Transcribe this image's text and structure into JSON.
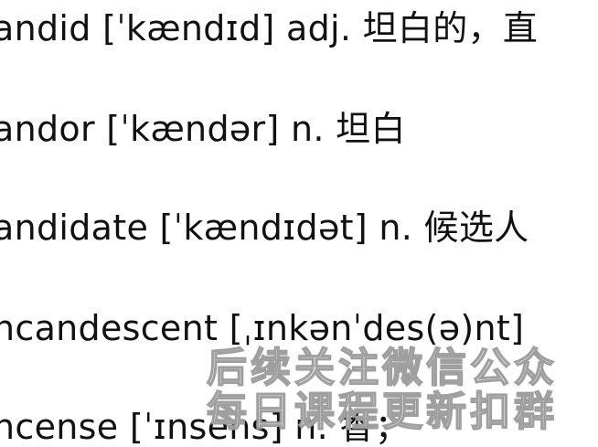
{
  "entries": [
    {
      "word": "andid",
      "phonetic": "[ˈkændɪd]",
      "pos": "adj.",
      "meaning": "坦白的，直"
    },
    {
      "word": "andor",
      "phonetic": "[ˈkændər]",
      "pos": "n.",
      "meaning": "坦白"
    },
    {
      "word": "andidate",
      "phonetic": "[ˈkændɪdət]",
      "pos": "n.",
      "meaning": "候选人"
    },
    {
      "word": "ncandescent",
      "phonetic": "[ˌɪnkənˈdes(ə)nt]",
      "pos": "",
      "meaning": ""
    },
    {
      "word": "ncense",
      "phonetic": "[ˈɪnsens]",
      "pos": "n.",
      "meaning": "香；"
    }
  ],
  "overlay": {
    "line1": "后续关注微信公众",
    "line2": "每日课程更新扣群"
  }
}
